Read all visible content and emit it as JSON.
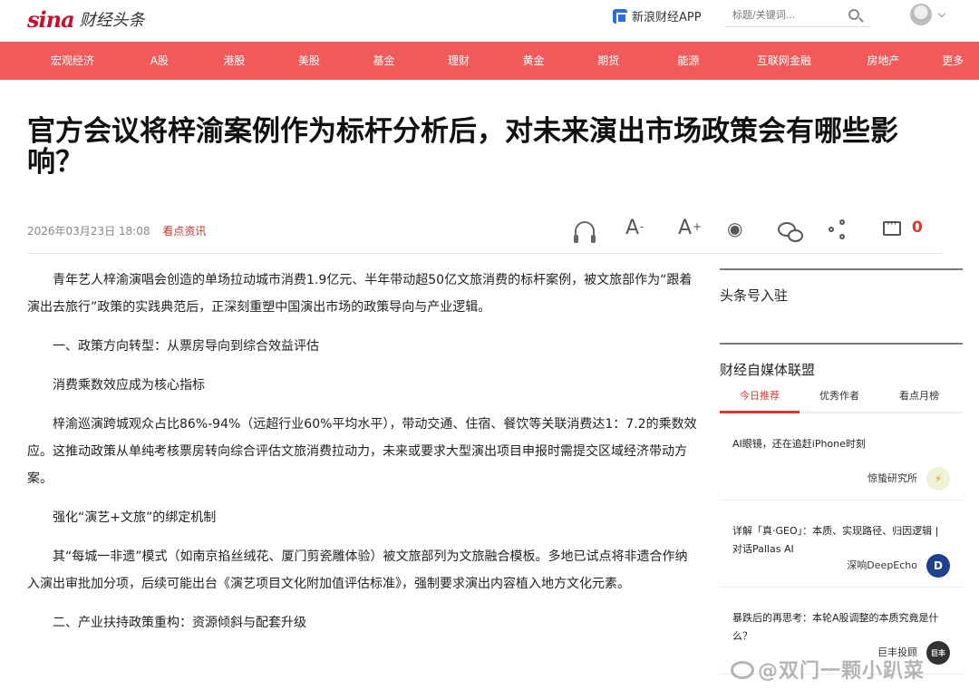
{
  "header": {
    "logo_brand": "sina",
    "logo_channel": "财经头条",
    "app_link": "新浪财经APP",
    "search_placeholder": "标题/关键词..."
  },
  "nav": {
    "items": [
      "宏观经济",
      "A股",
      "港股",
      "美股",
      "基金",
      "理财",
      "黄金",
      "期货",
      "能源",
      "互联网金融",
      "房地产",
      "更多"
    ]
  },
  "article": {
    "title": "官方会议将梓渝案例作为标杆分析后，对未来演出市场政策会有哪些影响？",
    "date": "2026年03月23日 18:08",
    "source": "看点资讯",
    "comment_count": "0",
    "paragraphs": [
      "青年艺人梓渝演唱会创造的单场拉动城市消费1.9亿元、半年带动超50亿文旅消费的标杆案例，被文旅部作为“跟着演出去旅行”政策的实践典范后，正深刻重塑中国演出市场的政策导向与产业逻辑。",
      "一、政策方向转型：从票房导向到综合效益评估",
      "消费乘数效应成为核心指标",
      "梓渝巡演跨城观众占比86%-94%（远超行业60%平均水平），带动交通、住宿、餐饮等关联消费达1：7.2的乘数效应。这推动政策从单纯考核票房转向综合评估文旅消费拉动力，未来或要求大型演出项目申报时需提交区域经济带动方案。",
      "强化“演艺+文旅”的绑定机制",
      "其“每城一非遗”模式（如南京掐丝绒花、厦门剪瓷雕体验）被文旅部列为文旅融合模板。多地已试点将非遗合作纳入演出审批加分项，后续可能出台《演艺项目文化附加值评估标准》，强制要求演出内容植入地方文化元素。",
      "二、产业扶持政策重构：资源倾斜与配套升级"
    ]
  },
  "sidebar": {
    "section1": "头条号入驻",
    "section2": "财经自媒体联盟",
    "tabs": [
      "今日推荐",
      "优秀作者",
      "看点月榜"
    ],
    "feed": [
      {
        "title": "AI眼镜，还在追赶iPhone时刻",
        "author": "惊蛰研究所",
        "avatar": "⚡",
        "avatar_color": "#f1f1d8"
      },
      {
        "title": "详解「真·GEO」：本质、实现路径、归因逻辑 | 对话Pallas AI",
        "author": "深响DeepEcho",
        "avatar": "D",
        "avatar_color": "#1f3f8f"
      },
      {
        "title": "暴跌后的再思考：本轮A股调整的本质究竟是什么？",
        "author": "巨丰投顾",
        "avatar": "巨丰",
        "avatar_color": "#333333"
      }
    ]
  },
  "watermark": "@双门一颗小趴菜",
  "colors": {
    "nav_bg": "#f05a5a",
    "accent": "#e0342f"
  }
}
